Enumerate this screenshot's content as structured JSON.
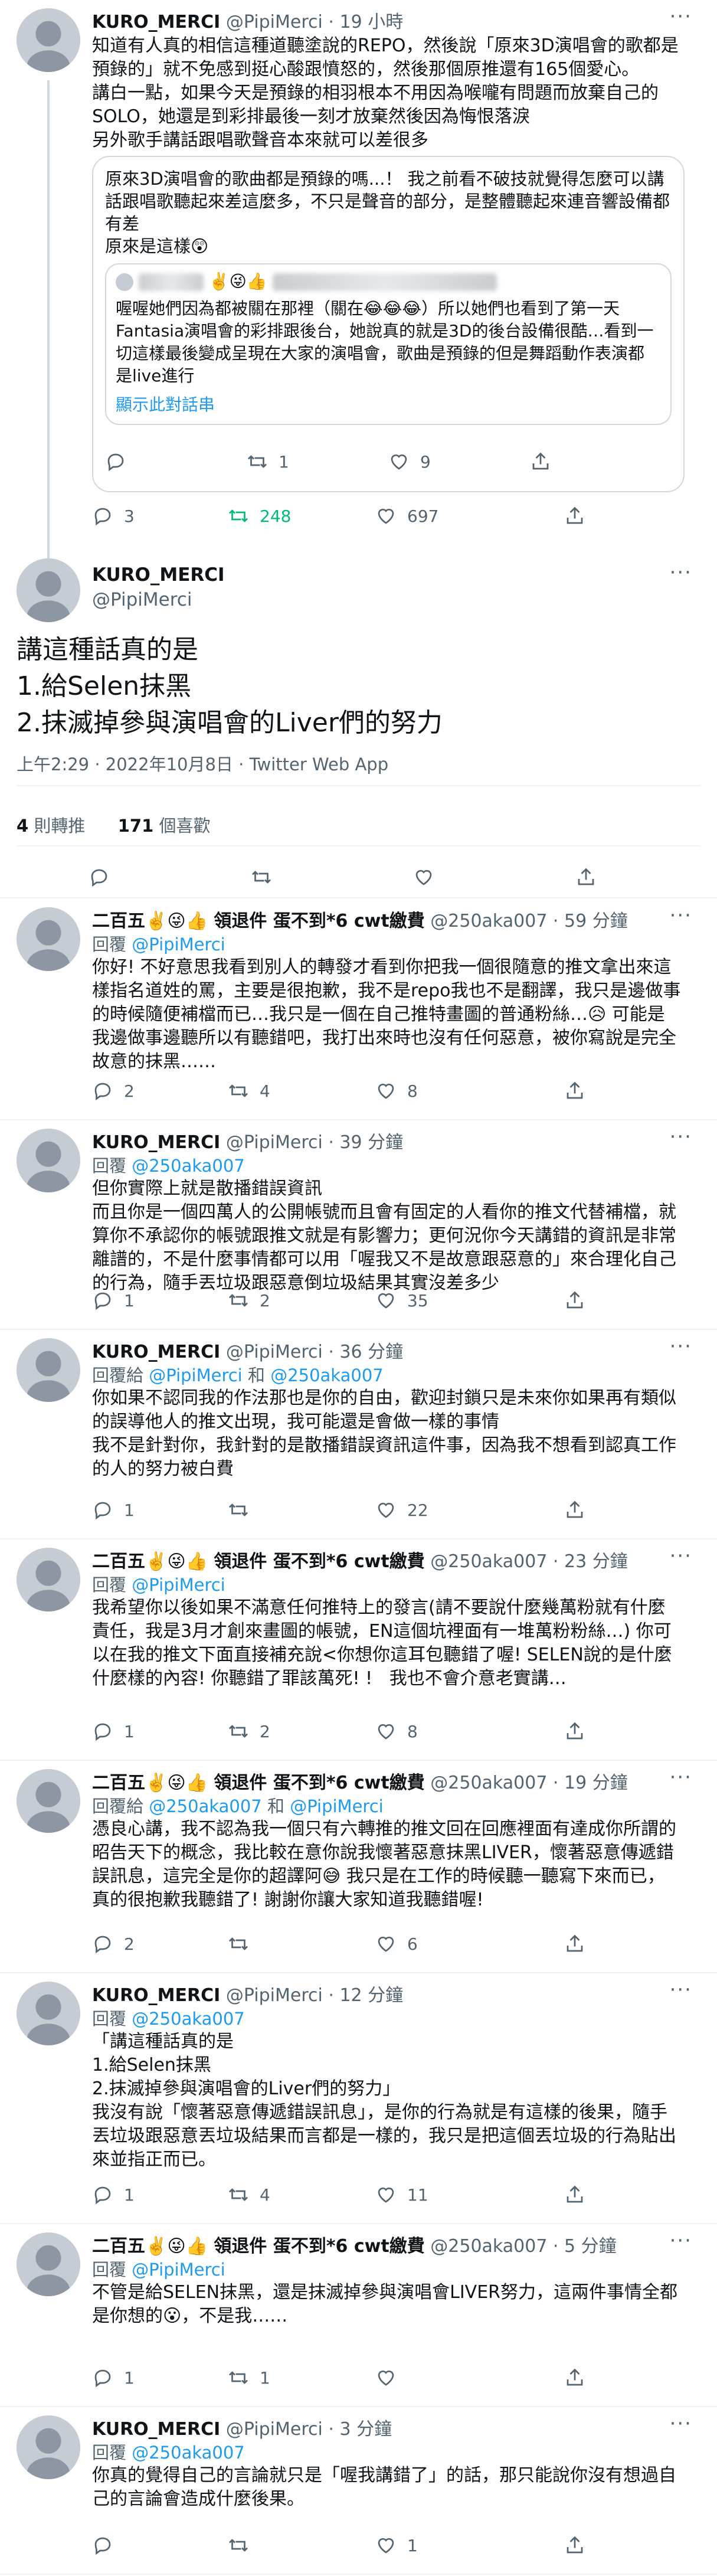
{
  "colors": {
    "link": "#1d9bf0",
    "retweet": "#00ba7c",
    "text": "#0f1419",
    "muted": "#536471"
  },
  "top_tweet": {
    "name": "KURO_MERCI",
    "handle": "@PipiMerci",
    "time": "· 19 小時",
    "body": "知道有人真的相信這種道聽塗說的REPO，然後說「原來3D演唱會的歌都是預錄的」就不免感到挺心酸跟憤怒的，然後那個原推還有165個愛心。\n講白一點，如果今天是預錄的相羽根本不用因為喉嚨有問題而放棄自己的SOLO，她還是到彩排最後一刻才放棄然後因為悔恨落淚\n另外歌手講話跟唱歌聲音本來就可以差很多",
    "quote": {
      "body": "原來3D演唱會的歌曲都是預錄的嗎...！ 我之前看不破技就覺得怎麼可以講話跟唱歌聽起來差這麼多，不只是聲音的部分，是整體聽起來連音響設備都有差\n原來是這樣😲",
      "inner": {
        "name_suffix": "✌️😜👍",
        "body": "喔喔她們因為都被關在那裡（關在😂😂😂）所以她們也看到了第一天Fantasia演唱會的彩排跟後台，她說真的就是3D的後台設備很酷…看到一切這樣最後變成呈現在大家的演唱會，歌曲是預錄的但是舞蹈動作表演都是live進行",
        "show_thread": "顯示此對話串"
      },
      "reply": "",
      "retweet": "1",
      "like": "9"
    },
    "stats": {
      "reply": "3",
      "retweet": "248",
      "like": "697"
    }
  },
  "main_tweet": {
    "name": "KURO_MERCI",
    "handle": "@PipiMerci",
    "body": "講這種話真的是\n1.給Selen抹黑\n2.抹滅掉參與演唱會的Liver們的努力",
    "timestamp": "上午2:29 · 2022年10月8日 · Twitter Web App",
    "retweets_count": "4",
    "retweets_label": "則轉推",
    "likes_count": "171",
    "likes_label": "個喜歡"
  },
  "replies": [
    {
      "name": "二百五✌️😜👍 領退件 蛋不到*6 cwt繳費",
      "handle": "@250aka007 · 59 分鐘",
      "reply_prefix": "回覆 ",
      "reply_to": "@PipiMerci",
      "reply_mid": "",
      "reply_to2": "",
      "body": "你好! 不好意思我看到別人的轉發才看到你把我一個很隨意的推文拿出來這樣指名道姓的罵，主要是很抱歉，我不是repo我也不是翻譯，我只是邊做事的時候隨便補檔而已…我只是一個在自己推特畫圖的普通粉絲…😥 可能是我邊做事邊聽所以有聽錯吧，我打出來時也沒有任何惡意，被你寫說是完全故意的抹黑……",
      "reply": "2",
      "retweet": "4",
      "like": "8"
    },
    {
      "name": "KURO_MERCI",
      "handle": "@PipiMerci · 39 分鐘",
      "reply_prefix": "回覆 ",
      "reply_to": "@250aka007",
      "reply_mid": "",
      "reply_to2": "",
      "body": "但你實際上就是散播錯誤資訊\n而且你是一個四萬人的公開帳號而且會有固定的人看你的推文代替補檔，就算你不承認你的帳號跟推文就是有影響力；更何況你今天講錯的資訊是非常離譜的，不是什麼事情都可以用「喔我又不是故意跟惡意的」來合理化自己的行為，隨手丟垃圾跟惡意倒垃圾結果其實沒差多少",
      "reply": "1",
      "retweet": "2",
      "like": "35"
    },
    {
      "name": "KURO_MERCI",
      "handle": "@PipiMerci · 36 分鐘",
      "reply_prefix": "回覆給 ",
      "reply_to": "@PipiMerci",
      "reply_mid": " 和 ",
      "reply_to2": "@250aka007",
      "body": "你如果不認同我的作法那也是你的自由，歡迎封鎖只是未來你如果再有類似的誤導他人的推文出現，我可能還是會做一樣的事情\n我不是針對你，我針對的是散播錯誤資訊這件事，因為我不想看到認真工作的人的努力被白費",
      "reply": "1",
      "retweet": "",
      "like": "22"
    },
    {
      "name": "二百五✌️😜👍 領退件 蛋不到*6 cwt繳費",
      "handle": "@250aka007 · 23 分鐘",
      "reply_prefix": "回覆 ",
      "reply_to": "@PipiMerci",
      "reply_mid": "",
      "reply_to2": "",
      "body": "我希望你以後如果不滿意任何推特上的發言(請不要說什麼幾萬粉就有什麼責任，我是3月才創來畫圖的帳號，EN這個坑裡面有一堆萬粉粉絲…) 你可以在我的推文下面直接補充說<你想你這耳包聽錯了喔! SELEN說的是什麼什麼樣的內容! 你聽錯了罪該萬死! !   我也不會介意老實講…",
      "reply": "1",
      "retweet": "2",
      "like": "8"
    },
    {
      "name": "二百五✌️😜👍 領退件 蛋不到*6 cwt繳費",
      "handle": "@250aka007 · 19 分鐘",
      "reply_prefix": "回覆給 ",
      "reply_to": "@250aka007",
      "reply_mid": " 和 ",
      "reply_to2": "@PipiMerci",
      "body": "憑良心講，我不認為我一個只有六轉推的推文回在回應裡面有達成你所謂的昭告天下的概念，我比較在意你說我懷著惡意抹黑LIVER，懷著惡意傳遞錯誤訊息，這完全是你的超譯阿😅 我只是在工作的時候聽一聽寫下來而已，真的很抱歉我聽錯了! 謝謝你讓大家知道我聽錯喔!",
      "reply": "2",
      "retweet": "",
      "like": "6"
    },
    {
      "name": "KURO_MERCI",
      "handle": "@PipiMerci · 12 分鐘",
      "reply_prefix": "回覆 ",
      "reply_to": "@250aka007",
      "reply_mid": "",
      "reply_to2": "",
      "body": "「講這種話真的是\n1.給Selen抹黑\n2.抹滅掉參與演唱會的Liver們的努力」\n我沒有說「懷著惡意傳遞錯誤訊息」，是你的行為就是有這樣的後果，隨手丟垃圾跟惡意丟垃圾結果而言都是一樣的，我只是把這個丟垃圾的行為貼出來並指正而已。",
      "reply": "1",
      "retweet": "4",
      "like": "11"
    },
    {
      "name": "二百五✌️😜👍 領退件 蛋不到*6 cwt繳費",
      "handle": "@250aka007 · 5 分鐘",
      "reply_prefix": "回覆 ",
      "reply_to": "@PipiMerci",
      "reply_mid": "",
      "reply_to2": "",
      "body": "不管是給SELEN抹黑，還是抹滅掉參與演唱會LIVER努力，這兩件事情全都是你想的😮，不是我……",
      "reply": "1",
      "retweet": "1",
      "like": ""
    },
    {
      "name": "KURO_MERCI",
      "handle": "@PipiMerci · 3 分鐘",
      "reply_prefix": "回覆 ",
      "reply_to": "@250aka007",
      "reply_mid": "",
      "reply_to2": "",
      "body": "你真的覺得自己的言論就只是「喔我講錯了」的話，那只能說你沒有想過自己的言論會造成什麼後果。",
      "reply": "",
      "retweet": "",
      "like": "1"
    }
  ],
  "icons": [
    "reply-icon",
    "retweet-icon",
    "like-icon",
    "share-icon",
    "more-icon"
  ]
}
